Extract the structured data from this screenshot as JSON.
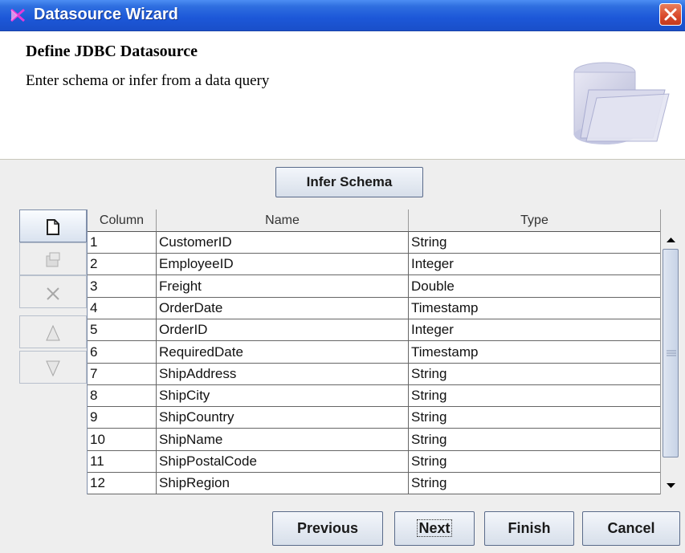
{
  "window": {
    "title": "Datasource Wizard"
  },
  "header": {
    "title": "Define JDBC Datasource",
    "subtitle": "Enter schema or infer from a data query"
  },
  "infer_button": "Infer Schema",
  "toolbar": [
    {
      "name": "new-icon",
      "enabled": true
    },
    {
      "name": "properties-icon",
      "enabled": false
    },
    {
      "name": "delete-icon",
      "enabled": false
    },
    {
      "name": "move-up-icon",
      "enabled": false
    },
    {
      "name": "move-down-icon",
      "enabled": false
    }
  ],
  "table": {
    "headers": [
      "Column",
      "Name",
      "Type"
    ],
    "rows": [
      [
        "1",
        "CustomerID",
        "String"
      ],
      [
        "2",
        "EmployeeID",
        "Integer"
      ],
      [
        "3",
        "Freight",
        "Double"
      ],
      [
        "4",
        "OrderDate",
        "Timestamp"
      ],
      [
        "5",
        "OrderID",
        "Integer"
      ],
      [
        "6",
        "RequiredDate",
        "Timestamp"
      ],
      [
        "7",
        "ShipAddress",
        "String"
      ],
      [
        "8",
        "ShipCity",
        "String"
      ],
      [
        "9",
        "ShipCountry",
        "String"
      ],
      [
        "10",
        "ShipName",
        "String"
      ],
      [
        "11",
        "ShipPostalCode",
        "String"
      ],
      [
        "12",
        "ShipRegion",
        "String"
      ]
    ]
  },
  "buttons": {
    "previous": "Previous",
    "next": "Next",
    "finish": "Finish",
    "cancel": "Cancel"
  }
}
